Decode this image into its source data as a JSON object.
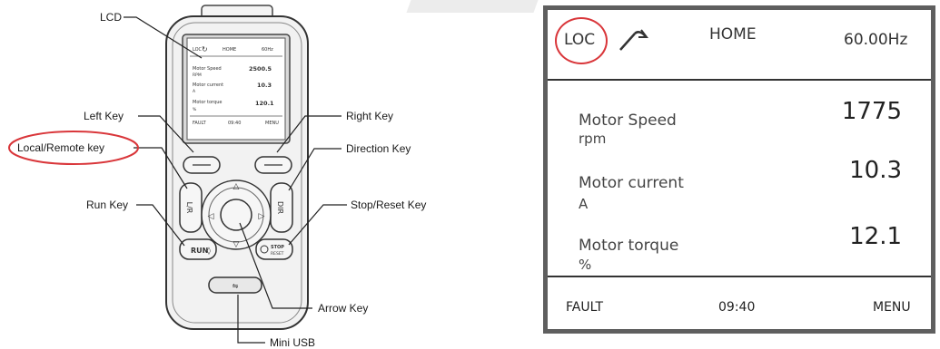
{
  "callouts": {
    "lcd": "LCD",
    "left_key": "Left Key",
    "local_remote_key": "Local/Remote key",
    "run_key": "Run Key",
    "right_key": "Right Key",
    "direction_key": "Direction Key",
    "stop_reset_key": "Stop/Reset Key",
    "arrow_key": "Arrow Key",
    "mini_usb": "Mini USB"
  },
  "mini_screen": {
    "mode": "LOC",
    "home": "HOME",
    "freq": "60Hz",
    "row1_name": "Motor Speed",
    "row1_value": "2500.5",
    "row1_unit": "RPM",
    "row2_name": "Motor current",
    "row2_value": "10.3",
    "row2_unit": "A",
    "row3_name": "Motor torque",
    "row3_value": "120.1",
    "row3_unit": "%",
    "fault": "FAULT",
    "time": "09:40",
    "menu": "MENU"
  },
  "keypad_labels": {
    "lr_key": "L/R",
    "dir_key": "DIR",
    "run_key": "RUN",
    "stop_key": "STOP",
    "reset_key": "RESET"
  },
  "display": {
    "mode": "LOC",
    "title": "HOME",
    "frequency": "60.00Hz",
    "rows": [
      {
        "name": "Motor Speed",
        "unit": "rpm",
        "value": "1775"
      },
      {
        "name": "Motor current",
        "unit": "A",
        "value": "10.3"
      },
      {
        "name": "Motor torque",
        "unit": "%",
        "value": "12.1"
      }
    ],
    "footer": {
      "left": "FAULT",
      "center": "09:40",
      "right": "MENU"
    }
  },
  "colors": {
    "highlight": "#d9363a",
    "frame": "#5f5f5f"
  }
}
